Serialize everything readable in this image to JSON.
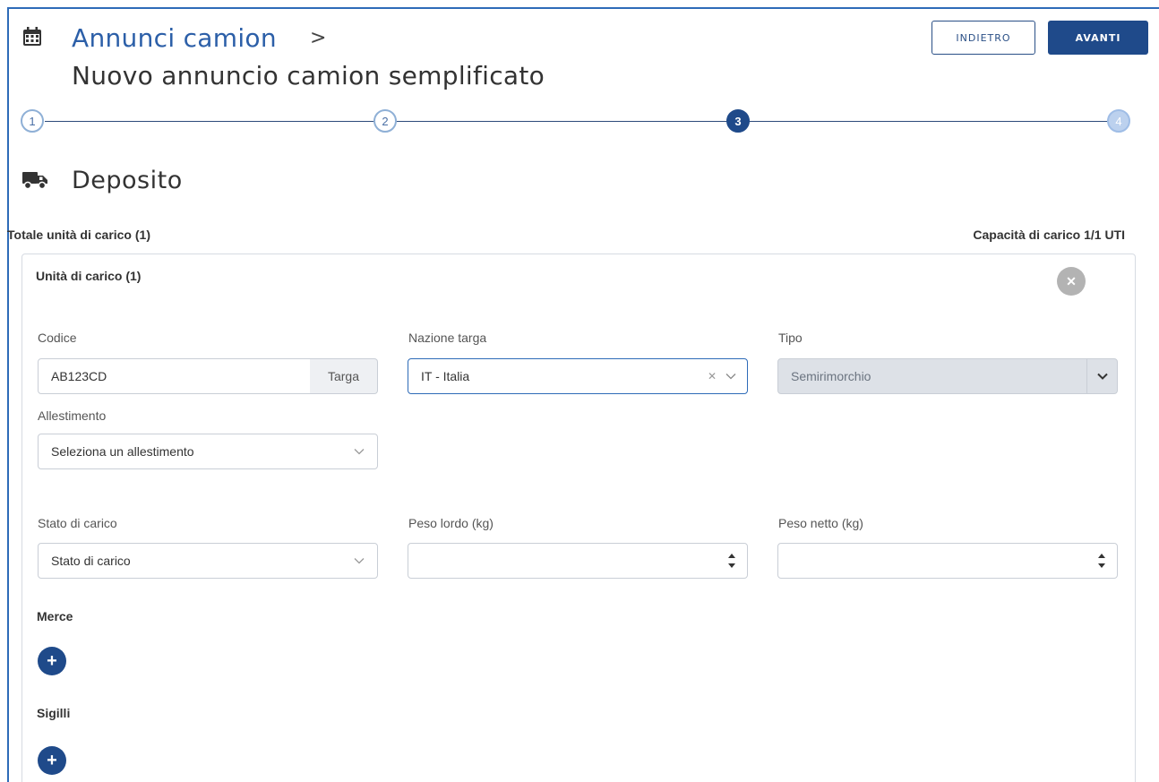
{
  "header": {
    "title": "Annunci camion",
    "chevron": ">",
    "subtitle": "Nuovo annuncio camion semplificato",
    "back_label": "INDIETRO",
    "next_label": "AVANTI"
  },
  "stepper": {
    "steps": [
      "1",
      "2",
      "3",
      "4"
    ],
    "active_step": 3
  },
  "section": {
    "title": "Deposito",
    "totale": "Totale unità di carico (1)",
    "capacita": "Capacità di carico 1/1 UTI"
  },
  "unit": {
    "title": "Unità di carico (1)",
    "close_symbol": "✕",
    "codice_label": "Codice",
    "codice_value": "AB123CD",
    "codice_addon": "Targa",
    "nazione_label": "Nazione targa",
    "nazione_value": "IT - Italia",
    "tipo_label": "Tipo",
    "tipo_value": "Semirimorchio",
    "allestimento_label": "Allestimento",
    "allestimento_placeholder": "Seleziona un allestimento",
    "stato_label": "Stato di carico",
    "stato_placeholder": "Stato di carico",
    "peso_lordo_label": "Peso lordo (kg)",
    "peso_lordo_value": "",
    "peso_netto_label": "Peso netto (kg)",
    "peso_netto_value": "",
    "merce_label": "Merce",
    "sigilli_label": "Sigilli",
    "add_symbol": "+"
  },
  "colors": {
    "primary": "#1f4a8a",
    "title_blue": "#2c5fa8",
    "border": "#c9ced6",
    "disabled_bg": "#dde1e7"
  },
  "icons": {
    "header": "calendar-icon",
    "section": "truck-icon"
  }
}
